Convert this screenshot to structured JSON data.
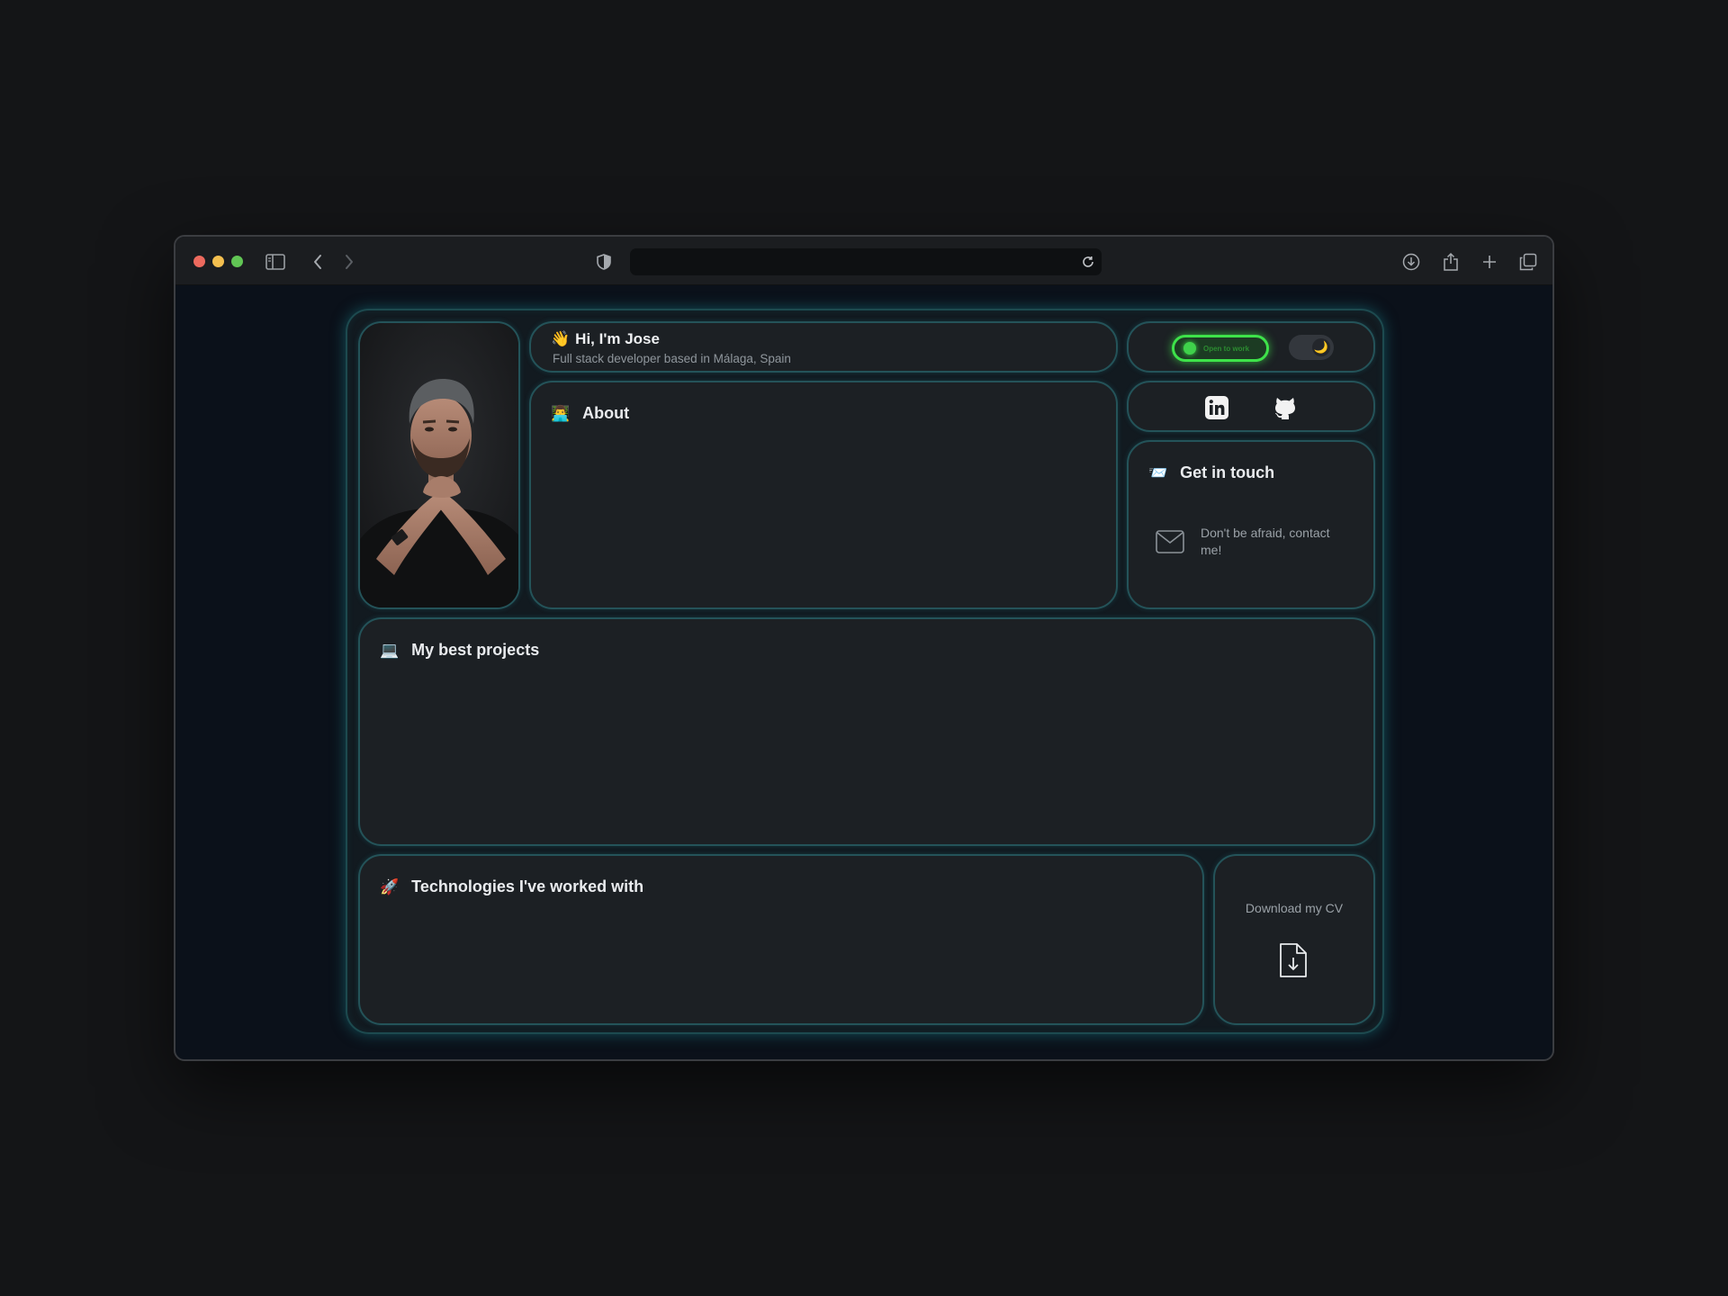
{
  "browser": {
    "url": "",
    "icons": [
      "sidebar-icon",
      "back-icon",
      "forward-icon",
      "shield-icon",
      "reload-icon",
      "download-icon",
      "share-icon",
      "new-tab-icon",
      "tabs-overview-icon"
    ]
  },
  "hero": {
    "emoji": "👋",
    "title": "Hi, I'm Jose",
    "subtitle": "Full stack developer based in Málaga, Spain"
  },
  "status": {
    "open_to_work_label": "Open to work",
    "theme": "dark",
    "theme_icon": "🌙"
  },
  "socials": [
    {
      "name": "LinkedIn",
      "icon": "linkedin-icon"
    },
    {
      "name": "GitHub",
      "icon": "github-icon"
    }
  ],
  "about": {
    "emoji": "👨‍💻",
    "title": "About"
  },
  "contact": {
    "emoji": "📨",
    "title": "Get in touch",
    "text": "Don't be afraid, contact me!"
  },
  "projects": {
    "emoji": "💻",
    "title": "My best projects"
  },
  "technologies": {
    "emoji": "🚀",
    "title": "Technologies I've worked with"
  },
  "cv": {
    "label": "Download my CV"
  },
  "colors": {
    "accent": "#245359",
    "glow": "#1e8c96",
    "status_green": "#3ee24a",
    "card_bg": "#1c2024"
  }
}
